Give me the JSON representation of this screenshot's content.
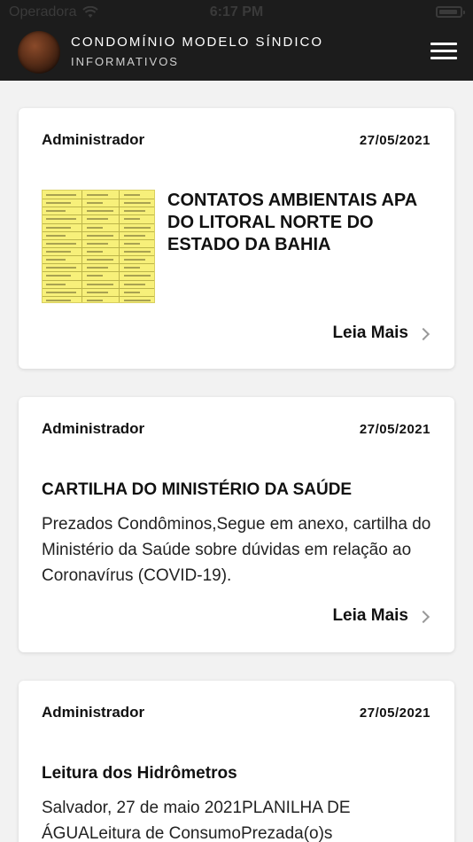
{
  "status_bar": {
    "carrier": "Operadora",
    "time": "6:17 PM"
  },
  "header": {
    "title": "CONDOMÍNIO MODELO SÍNDICO",
    "subtitle": "INFORMATIVOS"
  },
  "posts": [
    {
      "author": "Administrador",
      "date": "27/05/2021",
      "title": "CONTATOS AMBIENTAIS APA DO LITORAL NORTE DO ESTADO DA BAHIA",
      "excerpt": "",
      "read_more": "Leia Mais"
    },
    {
      "author": "Administrador",
      "date": "27/05/2021",
      "title": "CARTILHA DO MINISTÉRIO DA SAÚDE",
      "excerpt": "Prezados Condôminos,Segue em anexo, cartilha do Ministério da Saúde sobre dúvidas em relação ao Coronavírus (COVID-19).",
      "read_more": "Leia Mais"
    },
    {
      "author": "Administrador",
      "date": "27/05/2021",
      "title": "Leitura dos Hidrômetros",
      "excerpt": "Salvador,  27 de maio 2021PLANILHA DE ÁGUALeitura de ConsumoPrezada(o)s",
      "read_more": ""
    }
  ],
  "colors": {
    "header_bg": "#1c1c1c",
    "page_bg": "#f2f2f2",
    "card_bg": "#ffffff",
    "thumbnail": "#f7f07a"
  },
  "icons": {
    "menu": "hamburger-menu-icon",
    "read_more": "chevron-right-icon",
    "wifi": "wifi-icon",
    "battery": "battery-icon"
  }
}
